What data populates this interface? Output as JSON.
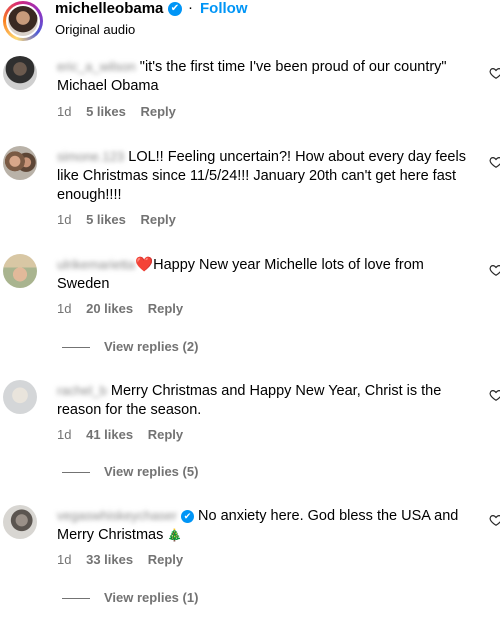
{
  "header": {
    "username": "michelleobama",
    "separator": "·",
    "follow_label": "Follow",
    "subtitle": "Original audio",
    "verified_icon": "✔"
  },
  "comments": [
    {
      "username": "eric_a_wilson",
      "text": "\"it's the first time I've been proud of our country\" Michael Obama",
      "time": "1d",
      "likes": "5 likes",
      "reply": "Reply"
    },
    {
      "username": "simone.123",
      "text": "LOL!! Feeling uncertain?! How about every day feels like Christmas since 11/5/24!!! January 20th can't get here fast enough!!!!",
      "time": "1d",
      "likes": "5 likes",
      "reply": "Reply"
    },
    {
      "username": "ulrikemarietta",
      "heart": "❤️",
      "text": "Happy New year Michelle lots of love from Sweden",
      "time": "1d",
      "likes": "20 likes",
      "reply": "Reply",
      "view_replies": "View replies (2)"
    },
    {
      "username": "rachel_b",
      "text": "Merry Christmas and Happy New Year, Christ is the reason for the season.",
      "time": "1d",
      "likes": "41 likes",
      "reply": "Reply",
      "view_replies": "View replies (5)"
    },
    {
      "username": "vegaswhiskeychaser",
      "text": "No anxiety here. God bless the USA and Merry Christmas",
      "tree": "🎄",
      "time": "1d",
      "likes": "33 likes",
      "reply": "Reply",
      "view_replies": "View replies (1)"
    }
  ],
  "colors": {
    "accent": "#0095f6",
    "muted": "#737373",
    "heart_red": "#e0245e"
  }
}
